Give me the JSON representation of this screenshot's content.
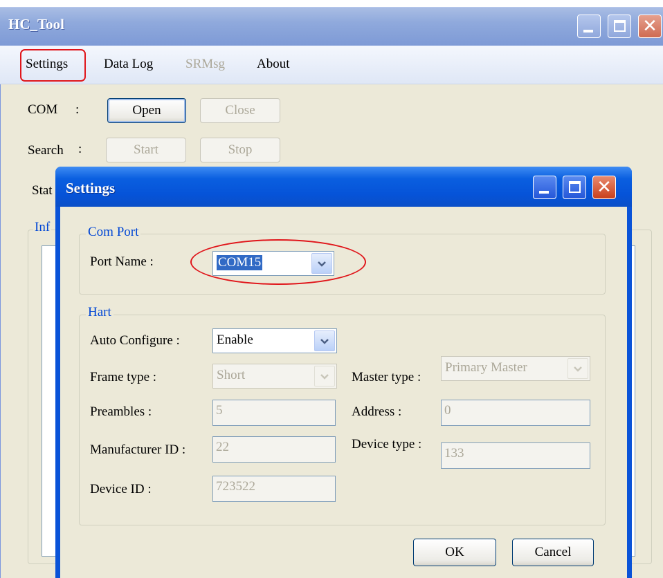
{
  "main_window": {
    "title": "HC_Tool",
    "menu": [
      "Settings",
      "Data Log",
      "SRMsg",
      "About"
    ],
    "com_label": "COM",
    "colon": ":",
    "search_label": "Search",
    "status_label": "Stat",
    "info_label": "Inf",
    "buttons": {
      "open": "Open",
      "close": "Close",
      "start": "Start",
      "stop": "Stop"
    }
  },
  "settings_dialog": {
    "title": "Settings",
    "com_port_group": "Com Port",
    "port_name_label": "Port Name :",
    "port_name_value": "COM15",
    "hart_group": "Hart",
    "auto_configure_label": "Auto Configure :",
    "auto_configure_value": "Enable",
    "frame_type_label": "Frame type :",
    "frame_type_value": "Short",
    "master_type_label": "Master type :",
    "master_type_value": "Primary Master",
    "preambles_label": "Preambles :",
    "preambles_value": "5",
    "address_label": "Address :",
    "address_value": "0",
    "manufacturer_id_label": "Manufacturer ID :",
    "manufacturer_id_value": "22",
    "device_type_label": "Device type :",
    "device_type_value": "133",
    "device_id_label": "Device ID :",
    "device_id_value": "723522",
    "ok": "OK",
    "cancel": "Cancel"
  },
  "colors": {
    "highlight_red": "#e0161b",
    "dialog_title_blue": "#0a53d8",
    "group_label_blue": "#0046d5",
    "selection_blue": "#316ac5"
  },
  "icons": [
    "minimize-icon",
    "maximize-icon",
    "close-icon",
    "chevron-down-icon"
  ]
}
